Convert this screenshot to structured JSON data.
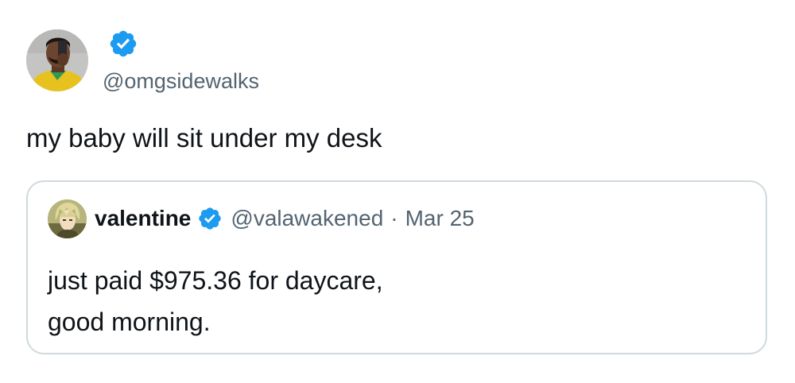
{
  "author": {
    "handle": "@omgsidewalks",
    "verified": true,
    "avatar_icon": "selfie-person-avatar"
  },
  "tweet": {
    "text": "my baby will sit under my desk"
  },
  "quoted_tweet": {
    "name": "valentine",
    "verified": true,
    "handle": "@valawakened",
    "separator": "·",
    "date": "Mar 25",
    "avatar_icon": "anime-character-avatar",
    "text_lines": [
      "just paid $975.36 for daycare,",
      "good morning."
    ]
  },
  "colors": {
    "verified_blue": "#1d9bf0",
    "secondary_text": "#536471",
    "primary_text": "#0f1419",
    "border": "#cfd9de"
  }
}
